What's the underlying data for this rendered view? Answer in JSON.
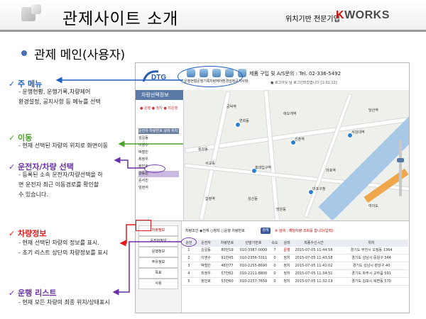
{
  "header": {
    "title": "관제사이트 소개",
    "tagline": "위치기반 전문기업",
    "brand_k": "K",
    "brand_rest": "WORKS"
  },
  "subtitle": "관제 메인(사용자)",
  "notes": [
    {
      "heading": "주 메뉴",
      "lines": [
        "- 운행현황, 운행기록,차량제어",
        "  환경설정, 공지사항 등 메뉴를 선택"
      ],
      "color": "#1d5fc4"
    },
    {
      "heading": "이동",
      "lines": [
        "- 현재 선택된 차량의 위치로 화면이동"
      ],
      "color": "#4aa029"
    },
    {
      "heading": "운전자/차량 선택",
      "lines": [
        "- 등록된 소속 운전자/차량선택을 하",
        "   면  운전자 최근 이동경로를 확인할",
        "   수 있습니다."
      ],
      "color": "#6a2fa6"
    },
    {
      "heading": "차량정보",
      "lines": [
        "- 현재 선택된 차량의 정보를 표시.",
        "- 초기 리스트 상단의 차량정보를 표시"
      ],
      "color": "#e01a1a"
    },
    {
      "heading": "운행 리스트",
      "lines": [
        "- 현재 모든 차량의 최종 위치/상태표시"
      ],
      "color": "#6a2fa6"
    }
  ],
  "app": {
    "logo_text": "DTG",
    "top_menu": [
      "운행현황",
      "운행기록",
      "차량제어",
      "환경설정",
      "공지사항"
    ],
    "tel": "제품 구입 및 A/S문의 : Tel. 02-336-5492",
    "login": "● 로그아웃  님 로그인되었습니다  [1:31:12]",
    "side_title": "차량선택정보",
    "legend": "● 운행  ● 정차  ● 미운행",
    "side_headers": [
      "운전자",
      "차량번호",
      "상태",
      "위치"
    ],
    "vehicle_names": [
      "김길동",
      "이영수",
      "박철민",
      "최정우",
      "정민호",
      "강동원",
      "윤서진",
      "임현석"
    ],
    "info_boxes": [
      "차량정보",
      "운전자정보",
      "운행정보",
      "주유정보",
      "목표",
      "사용"
    ],
    "search_label": "차량조건 ◉전체 ○정차 ○운행  차량번호",
    "search_btn": "검색",
    "search_note": "※ 검색 : 해당차량 조회를 합니다(입력)",
    "map_labels": [
      "연희동",
      "신촌역",
      "홍대입구역",
      "서강대역",
      "마포구청",
      "합정역",
      "당산역",
      "여의도",
      "공덕역",
      "애오개역",
      "마포역",
      "용강동",
      "성산동",
      "망원동",
      "서교동"
    ],
    "grid_headers": [
      "순번",
      "운전자",
      "차량번호",
      "단말기번호",
      "속도",
      "상태",
      "최종수신시간",
      "위치"
    ],
    "grid_rows": [
      [
        "1",
        "김길동",
        "80만19",
        "010-3387-0000",
        "7",
        "운행",
        "2015-07-05 11:44:58",
        "경기도 부천시 오정동 1364"
      ],
      [
        "2",
        "이영수",
        "91만45",
        "010-2356-3311",
        "0",
        "정차",
        "2015-07-05 11:43:58",
        "경기도 성남시 중원구 344"
      ],
      [
        "3",
        "박철민",
        "46만77",
        "010-2255-8690",
        "0",
        "정차",
        "2015-07-05 11:41:02",
        "경기도 성남시 분당구 40"
      ],
      [
        "4",
        "최정우",
        "57만62",
        "010-2211-8800",
        "0",
        "정차",
        "2015-07-05 11:34:51",
        "경기도 파주시 교하읍 591"
      ],
      [
        "5",
        "정민호",
        "53만60",
        "010-2237-7650",
        "0",
        "정차",
        "2015-07-05 11:32:19",
        "경기도 김포시 북변동 570"
      ]
    ]
  },
  "colors": {
    "accent_blue": "#1d5fc4",
    "accent_green": "#4aa029",
    "accent_purple": "#6a2fa6",
    "accent_red": "#e01a1a"
  }
}
